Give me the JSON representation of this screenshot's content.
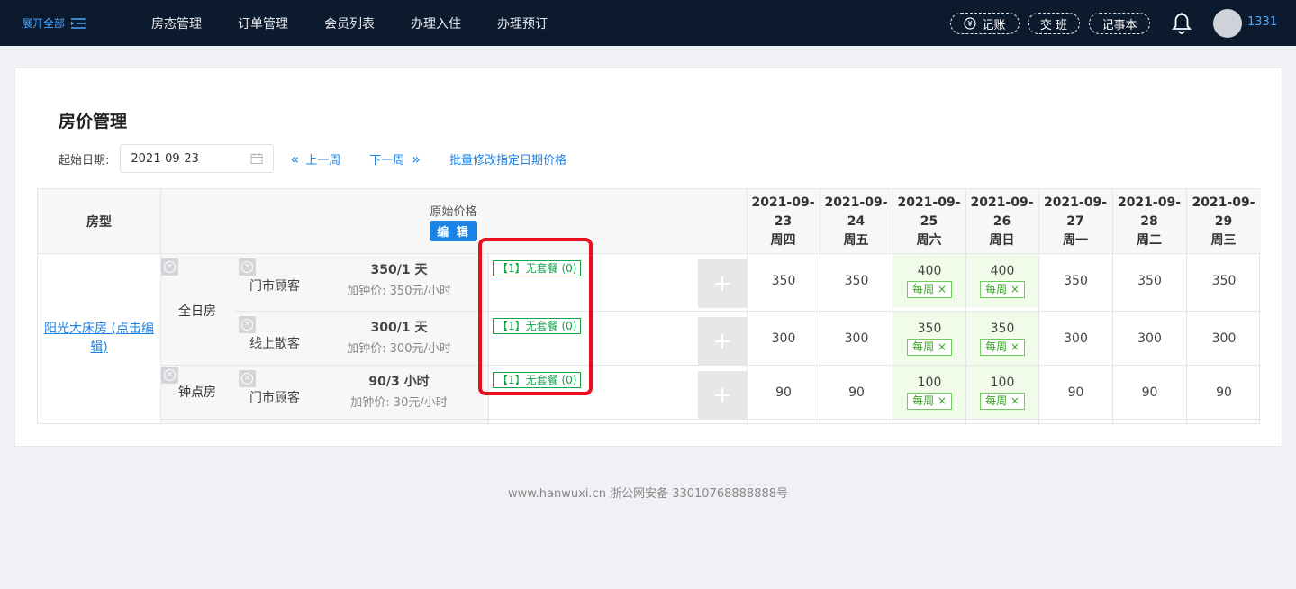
{
  "topbar": {
    "expand_label": "展开全部",
    "nav": [
      "房态管理",
      "订单管理",
      "会员列表",
      "办理入住",
      "办理预订"
    ],
    "btn_account": "记账",
    "btn_shift": "交 班",
    "btn_notes": "记事本",
    "username": "1331"
  },
  "page": {
    "title": "房价管理",
    "date_label": "起始日期:",
    "date_value": "2021-09-23",
    "prev_week": "上一周",
    "next_week": "下一周",
    "batch_edit": "批量修改指定日期价格"
  },
  "table": {
    "col_room": "房型",
    "col_price": "原始价格",
    "edit_label": "编 辑",
    "dates": [
      {
        "d1": "2021-09-",
        "d2": "23",
        "wd": "周四"
      },
      {
        "d1": "2021-09-",
        "d2": "24",
        "wd": "周五"
      },
      {
        "d1": "2021-09-",
        "d2": "25",
        "wd": "周六"
      },
      {
        "d1": "2021-09-",
        "d2": "26",
        "wd": "周日"
      },
      {
        "d1": "2021-09-",
        "d2": "27",
        "wd": "周一"
      },
      {
        "d1": "2021-09-",
        "d2": "28",
        "wd": "周二"
      },
      {
        "d1": "2021-09-",
        "d2": "29",
        "wd": "周三"
      }
    ],
    "room_name": "阳光大床房 (点击编辑)",
    "room_name_l1": "阳光大床房 (点击编",
    "room_name_l2": "辑)",
    "types": [
      "全日房",
      "钟点房"
    ],
    "rows": [
      {
        "customer": "门市顾客",
        "price": "350/1 天",
        "extra": "加钟价: 350元/小时",
        "package": "【1】无套餐 (0)",
        "values": [
          "350",
          "350",
          "400",
          "400",
          "350",
          "350",
          "350"
        ]
      },
      {
        "customer": "线上散客",
        "price": "300/1 天",
        "extra": "加钟价: 300元/小时",
        "package": "【1】无套餐 (0)",
        "values": [
          "300",
          "300",
          "350",
          "350",
          "300",
          "300",
          "300"
        ]
      },
      {
        "customer": "门市顾客",
        "price": "90/3 小时",
        "extra": "加钟价: 30元/小时",
        "package": "【1】无套餐 (0)",
        "values": [
          "90",
          "90",
          "100",
          "100",
          "90",
          "90",
          "90"
        ]
      }
    ],
    "weekly_tag": "每周 ×"
  },
  "footer": "www.hanwuxi.cn 浙公网安备 33010768888888号",
  "colors": {
    "topbar": "#0c1a2e",
    "accent": "#1a83e8",
    "highlight": "#e8101f",
    "weekend": "#f0fbe9"
  }
}
